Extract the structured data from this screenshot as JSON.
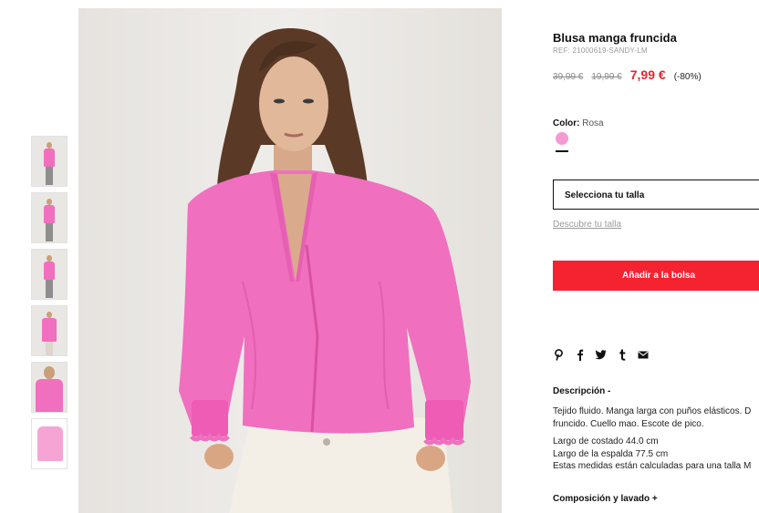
{
  "product": {
    "title": "Blusa manga fruncida",
    "ref": "REF: 21000619-SANDY-LM",
    "price_original": "39,99 €",
    "price_previous": "19,99 €",
    "price_current": "7,99 €",
    "discount": "(-80%)",
    "color_label": "Color:",
    "color_value": "Rosa",
    "swatch_color": "#f59ad1",
    "size_select_label": "Selecciona tu talla",
    "size_guide_link": "Descubre tu talla",
    "add_to_bag": "Añadir a la bolsa"
  },
  "social": {
    "icons": [
      "pinterest-icon",
      "facebook-icon",
      "twitter-icon",
      "tumblr-icon",
      "email-icon"
    ]
  },
  "description": {
    "heading": "Descripción -",
    "line1": "Tejido fluido. Manga larga con puños elásticos. D",
    "line2": "fruncido. Cuello mao. Escote de pico.",
    "measure1": "Largo de costado 44.0 cm",
    "measure2": "Largo de la espalda 77.5 cm",
    "measure3": "Estas medidas están calculadas para una talla M"
  },
  "composition": {
    "heading": "Composición y lavado +"
  },
  "colors": {
    "accent": "#f5232f",
    "price_sale": "#e3262f",
    "blouse": "#f06fbf"
  }
}
